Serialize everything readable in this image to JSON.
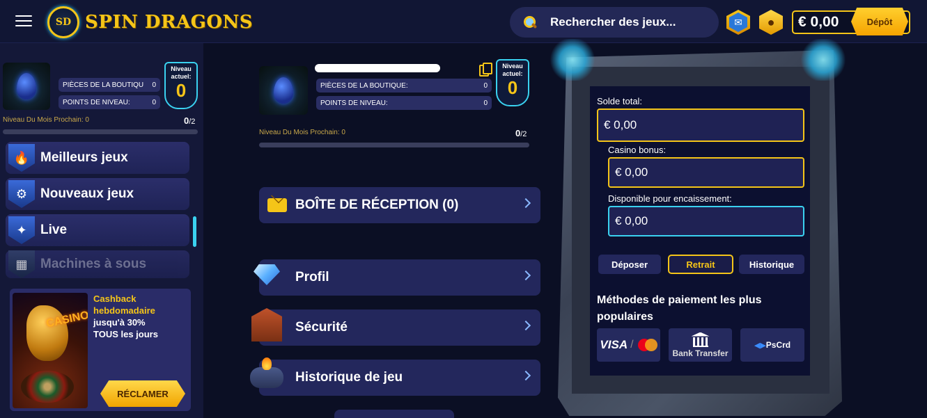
{
  "header": {
    "logo_initials": "SD",
    "logo_text": "SPIN DRAGONS",
    "search_placeholder": "Rechercher des jeux...",
    "balance": "€ 0,00",
    "deposit_label": "Dépôt"
  },
  "sidebar": {
    "shop_coins_label": "PIÈCES DE LA BOUTIQU",
    "shop_coins_value": "0",
    "level_points_label": "POINTS DE NIVEAU:",
    "level_points_value": "0",
    "level_badge_label": "Niveau actuel:",
    "level_badge_value": "0",
    "next_level_label": "Niveau Du Mois Prochain: 0",
    "next_level_count": "0",
    "next_level_total": "/2",
    "nav": [
      {
        "label": "Meilleurs jeux",
        "icon": "fire-icon"
      },
      {
        "label": "Nouveaux jeux",
        "icon": "cannon-icon"
      },
      {
        "label": "Live",
        "icon": "live-dealer-icon"
      },
      {
        "label": "Machines à sous",
        "icon": "slot-machine-icon"
      }
    ],
    "promo": {
      "sign": "CASINO",
      "title_line1": "Cashback",
      "title_line2": "hebdomadaire",
      "body_line1": "jusqu'à 30%",
      "body_line2": "TOUS les jours",
      "button": "RÉCLAMER"
    }
  },
  "profile": {
    "shop_coins_label": "PIÈCES DE LA BOUTIQUE:",
    "shop_coins_value": "0",
    "level_points_label": "POINTS DE NIVEAU:",
    "level_points_value": "0",
    "level_badge_label": "Niveau actuel:",
    "level_badge_value": "0",
    "next_level_label": "Niveau Du Mois Prochain: 0",
    "next_level_count": "0",
    "next_level_total": "/2"
  },
  "menu": [
    {
      "label": "BOÎTE DE RÉCEPTION (0)",
      "icon": "envelope-icon"
    },
    {
      "label": "Profil",
      "icon": "diamond-icon"
    },
    {
      "label": "Sécurité",
      "icon": "house-icon"
    },
    {
      "label": "Historique de jeu",
      "icon": "gamepad-icon"
    }
  ],
  "wallet": {
    "total_label": "Solde total:",
    "total_value": "€ 0,00",
    "bonus_label": "Casino bonus:",
    "bonus_value": "€ 0,00",
    "withdrawable_label": "Disponible pour encaissement:",
    "withdrawable_value": "€ 0,00",
    "tabs": [
      "Déposer",
      "Retrait",
      "Historique"
    ],
    "active_tab": "Retrait",
    "payment_title": "Méthodes de paiement les plus populaires",
    "methods": {
      "visa": "VISA",
      "mc_caption": "mastercard",
      "bank": "Bank Transfer",
      "pscard": "PsCrd"
    }
  },
  "colors": {
    "accent_gold": "#f5c518",
    "accent_cyan": "#3ad2f0",
    "panel_bg": "#0c1030",
    "item_bg": "#23275c"
  }
}
